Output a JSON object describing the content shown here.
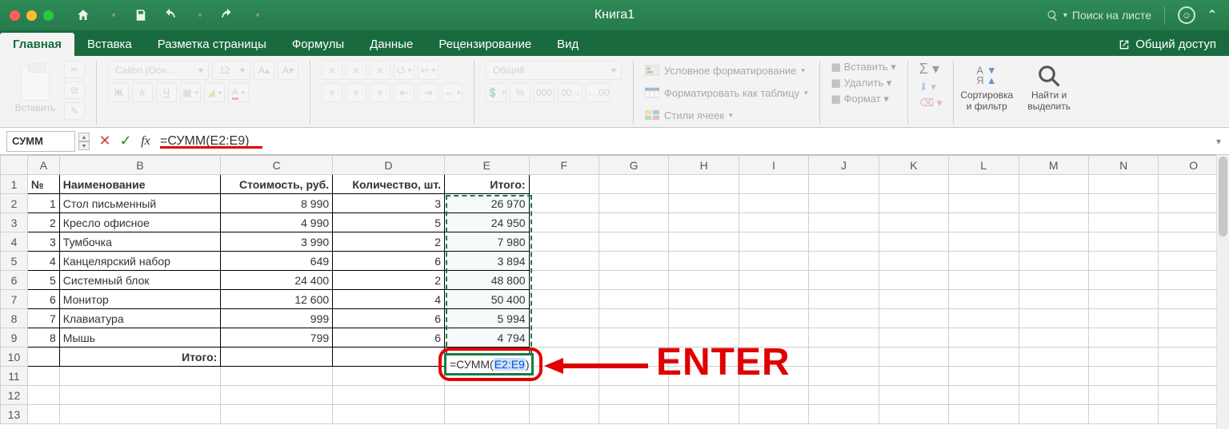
{
  "titlebar": {
    "title": "Книга1",
    "search_placeholder": "Поиск на листе"
  },
  "tabs": {
    "items": [
      "Главная",
      "Вставка",
      "Разметка страницы",
      "Формулы",
      "Данные",
      "Рецензирование",
      "Вид"
    ],
    "active": 0,
    "share": "Общий доступ"
  },
  "ribbon": {
    "paste": "Вставить",
    "font_name": "Calibri (Осн...",
    "font_size": "12",
    "numfmt": "Общий",
    "cond_format": "Условное форматирование",
    "as_table": "Форматировать как таблицу",
    "cell_styles": "Стили ячеек",
    "insert": "Вставить",
    "delete": "Удалить",
    "format": "Формат",
    "sort_filter": "Сортировка\nи фильтр",
    "find_select": "Найти и\nвыделить"
  },
  "formula_bar": {
    "name_box": "СУММ",
    "formula": "=СУММ(E2:E9)"
  },
  "columns": [
    "A",
    "B",
    "C",
    "D",
    "E",
    "F",
    "G",
    "H",
    "I",
    "J",
    "K",
    "L",
    "M",
    "N",
    "O"
  ],
  "headers": {
    "num": "№",
    "name": "Наименование",
    "cost": "Стоимость, руб.",
    "qty": "Количество, шт.",
    "total": "Итого:"
  },
  "rows": [
    {
      "n": "1",
      "name": "Стол письменный",
      "cost": "8 990",
      "qty": "3",
      "total": "26 970"
    },
    {
      "n": "2",
      "name": "Кресло офисное",
      "cost": "4 990",
      "qty": "5",
      "total": "24 950"
    },
    {
      "n": "3",
      "name": "Тумбочка",
      "cost": "3 990",
      "qty": "2",
      "total": "7 980"
    },
    {
      "n": "4",
      "name": "Канцелярский набор",
      "cost": "649",
      "qty": "6",
      "total": "3 894"
    },
    {
      "n": "5",
      "name": "Системный блок",
      "cost": "24 400",
      "qty": "2",
      "total": "48 800"
    },
    {
      "n": "6",
      "name": "Монитор",
      "cost": "12 600",
      "qty": "4",
      "total": "50 400"
    },
    {
      "n": "7",
      "name": "Клавиатура",
      "cost": "999",
      "qty": "6",
      "total": "5 994"
    },
    {
      "n": "8",
      "name": "Мышь",
      "cost": "799",
      "qty": "6",
      "total": "4 794"
    }
  ],
  "footer_label": "Итого:",
  "active_cell": {
    "prefix": "=СУММ(",
    "ref": "E2:E9",
    "suffix": ")"
  },
  "annotation": "ENTER"
}
